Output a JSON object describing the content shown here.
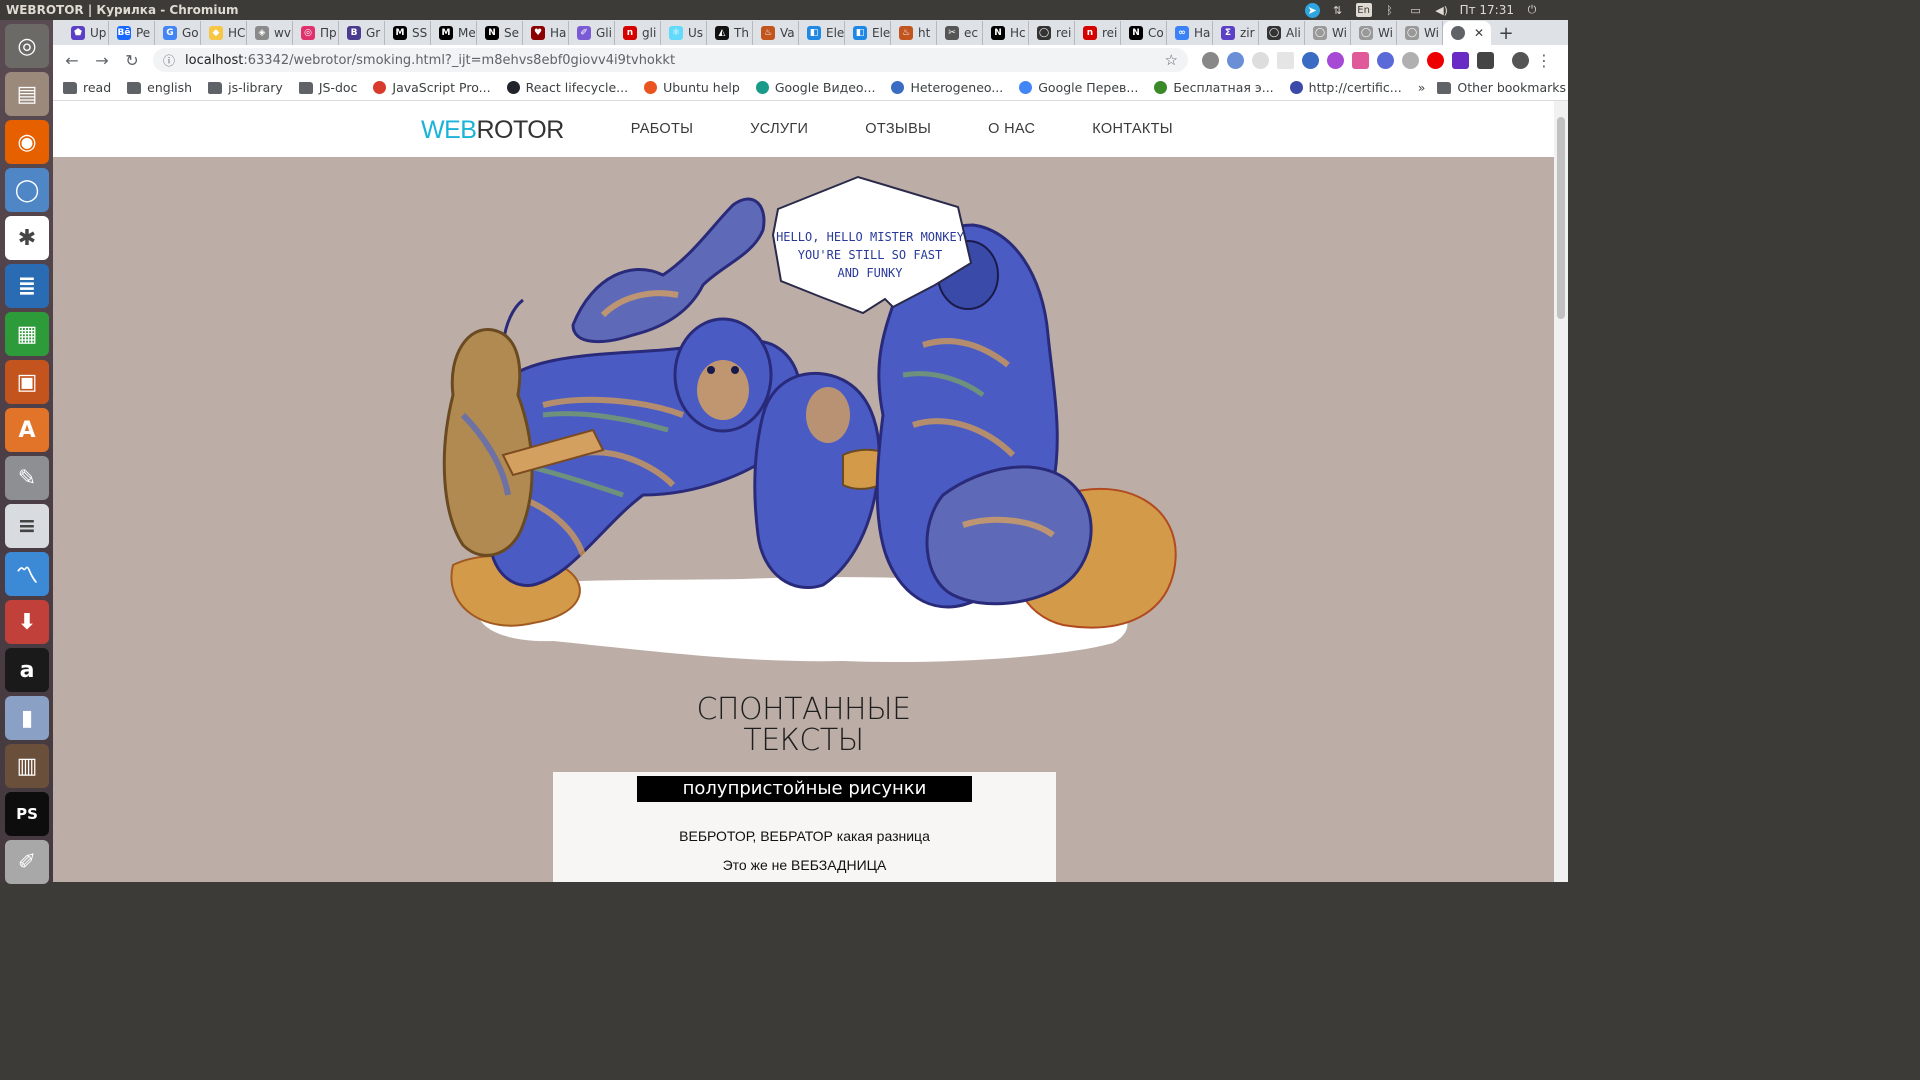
{
  "system": {
    "window_title": "WEBROTOR | Курилка - Chromium",
    "keyboard_layout": "En",
    "clock": "Пт 17:31"
  },
  "launcher": {
    "apps": [
      {
        "name": "ubuntu-dash-icon",
        "color": "#6b6a66",
        "glyph": "◎"
      },
      {
        "name": "files-icon",
        "color": "#9b8a7c",
        "glyph": "▤"
      },
      {
        "name": "firefox-icon",
        "color": "#e66000",
        "glyph": "◉"
      },
      {
        "name": "chromium-icon",
        "color": "#4f86c6",
        "glyph": "◯"
      },
      {
        "name": "slack-icon",
        "color": "#ffffff",
        "glyph": "✱"
      },
      {
        "name": "writer-icon",
        "color": "#2a6cb3",
        "glyph": "≣"
      },
      {
        "name": "calc-icon",
        "color": "#2e9b3a",
        "glyph": "▦"
      },
      {
        "name": "impress-icon",
        "color": "#c4541e",
        "glyph": "▣"
      },
      {
        "name": "software-center-icon",
        "color": "#e2742a",
        "glyph": "A"
      },
      {
        "name": "settings-icon",
        "color": "#8d8f92",
        "glyph": "✎"
      },
      {
        "name": "text-editor-icon",
        "color": "#d8dbe0",
        "glyph": "≡"
      },
      {
        "name": "system-monitor-icon",
        "color": "#3c8ad6",
        "glyph": "〽"
      },
      {
        "name": "installer-icon",
        "color": "#c2403a",
        "glyph": "⬇"
      },
      {
        "name": "amazon-icon",
        "color": "#1a1a1a",
        "glyph": "a"
      },
      {
        "name": "thermometer-icon",
        "color": "#8aa0c4",
        "glyph": "▮"
      },
      {
        "name": "library-icon",
        "color": "#6a4f3a",
        "glyph": "▥"
      },
      {
        "name": "phpstorm-icon",
        "color": "#0d0d0d",
        "glyph": "PS"
      },
      {
        "name": "editor-icon",
        "color": "#a8a8a8",
        "glyph": "✐"
      }
    ]
  },
  "tabs": [
    {
      "label": "Up",
      "color": "#5b3fc4",
      "glyph": "⬟"
    },
    {
      "label": "Pe",
      "color": "#1769ff",
      "glyph": "Bē"
    },
    {
      "label": "Go",
      "color": "#4285f4",
      "glyph": "G"
    },
    {
      "label": "HC",
      "color": "#f6c744",
      "glyph": "◆"
    },
    {
      "label": "wv",
      "color": "#8a8a8a",
      "glyph": "◈"
    },
    {
      "label": "Пр",
      "color": "#e1306c",
      "glyph": "◎"
    },
    {
      "label": "Gr",
      "color": "#4b3b8f",
      "glyph": "B"
    },
    {
      "label": "SS",
      "color": "#000000",
      "glyph": "M"
    },
    {
      "label": "Me",
      "color": "#000000",
      "glyph": "M"
    },
    {
      "label": "Se",
      "color": "#000000",
      "glyph": "N"
    },
    {
      "label": "На",
      "color": "#8b0000",
      "glyph": "♥"
    },
    {
      "label": "Gli",
      "color": "#7b5ad6",
      "glyph": "✐"
    },
    {
      "label": "gli",
      "color": "#d50000",
      "glyph": "n"
    },
    {
      "label": "Us",
      "color": "#61dafb",
      "glyph": "⚛"
    },
    {
      "label": "Th",
      "color": "#111111",
      "glyph": "◭"
    },
    {
      "label": "Va",
      "color": "#c2541e",
      "glyph": "♨"
    },
    {
      "label": "Ele",
      "color": "#1e88e5",
      "glyph": "◧"
    },
    {
      "label": "Ele",
      "color": "#1e88e5",
      "glyph": "◧"
    },
    {
      "label": "ht",
      "color": "#c2541e",
      "glyph": "♨"
    },
    {
      "label": "ec",
      "color": "#555555",
      "glyph": "✂"
    },
    {
      "label": "Нс",
      "color": "#000000",
      "glyph": "N"
    },
    {
      "label": "rei",
      "color": "#333333",
      "glyph": "◯"
    },
    {
      "label": "rei",
      "color": "#d50000",
      "glyph": "n"
    },
    {
      "label": "Co",
      "color": "#000000",
      "glyph": "N"
    },
    {
      "label": "На",
      "color": "#3b82f6",
      "glyph": "∞"
    },
    {
      "label": "zir",
      "color": "#5b3fc4",
      "glyph": "Σ"
    },
    {
      "label": "Ali",
      "color": "#333333",
      "glyph": "◯"
    },
    {
      "label": "Wi",
      "color": "#999999",
      "glyph": "◯"
    },
    {
      "label": "Wi",
      "color": "#999999",
      "glyph": "◯"
    },
    {
      "label": "Wi",
      "color": "#999999",
      "glyph": "◯"
    }
  ],
  "active_tab": {
    "close": "✕"
  },
  "address": {
    "host": "localhost",
    "rest": ":63342/webrotor/smoking.html?_ijt=m8ehvs8ebf0giovv4i9tvhokkt"
  },
  "bookmarks": [
    {
      "label": "read",
      "type": "folder"
    },
    {
      "label": "english",
      "type": "folder"
    },
    {
      "label": "js-library",
      "type": "folder"
    },
    {
      "label": "JS-doc",
      "type": "folder"
    },
    {
      "label": "JavaScript Pro...",
      "type": "site",
      "color": "#d83a2e",
      "glyph": "do"
    },
    {
      "label": "React lifecycle...",
      "type": "site",
      "color": "#20232a"
    },
    {
      "label": "Ubuntu help",
      "type": "site",
      "color": "#e95420"
    },
    {
      "label": "Google Видео...",
      "type": "site",
      "color": "#1a9b8a"
    },
    {
      "label": "Heterogeneo...",
      "type": "site",
      "color": "#3b6cc4"
    },
    {
      "label": "Google Перев...",
      "type": "site",
      "color": "#4285f4"
    },
    {
      "label": "Бесплатная э...",
      "type": "site",
      "color": "#3a8a2a"
    },
    {
      "label": "http://certific...",
      "type": "site",
      "color": "#3b4aa8"
    }
  ],
  "bookmarks_more": "»",
  "other_bookmarks": "Other bookmarks",
  "site": {
    "logo_part1": "WEB",
    "logo_part2": "ROTOR",
    "nav": [
      "РАБОТЫ",
      "УСЛУГИ",
      "ОТЗЫВЫ",
      "О НАС",
      "КОНТАКТЫ"
    ],
    "speech_line1": "HELLO, HELLO MISTER MONKEY",
    "speech_line2": "YOU'RE STILL SO FAST",
    "speech_line3": "AND FUNKY",
    "headline_line1": "СПОНТАННЫЕ",
    "headline_line2": "ТЕКСТЫ",
    "subtitle": "полупристойные рисунки",
    "paragraph1": "ВЕБРОТОР, ВЕБРАТОР какая разница",
    "paragraph2": "Это же не ВЕБЗАДНИЦА"
  }
}
